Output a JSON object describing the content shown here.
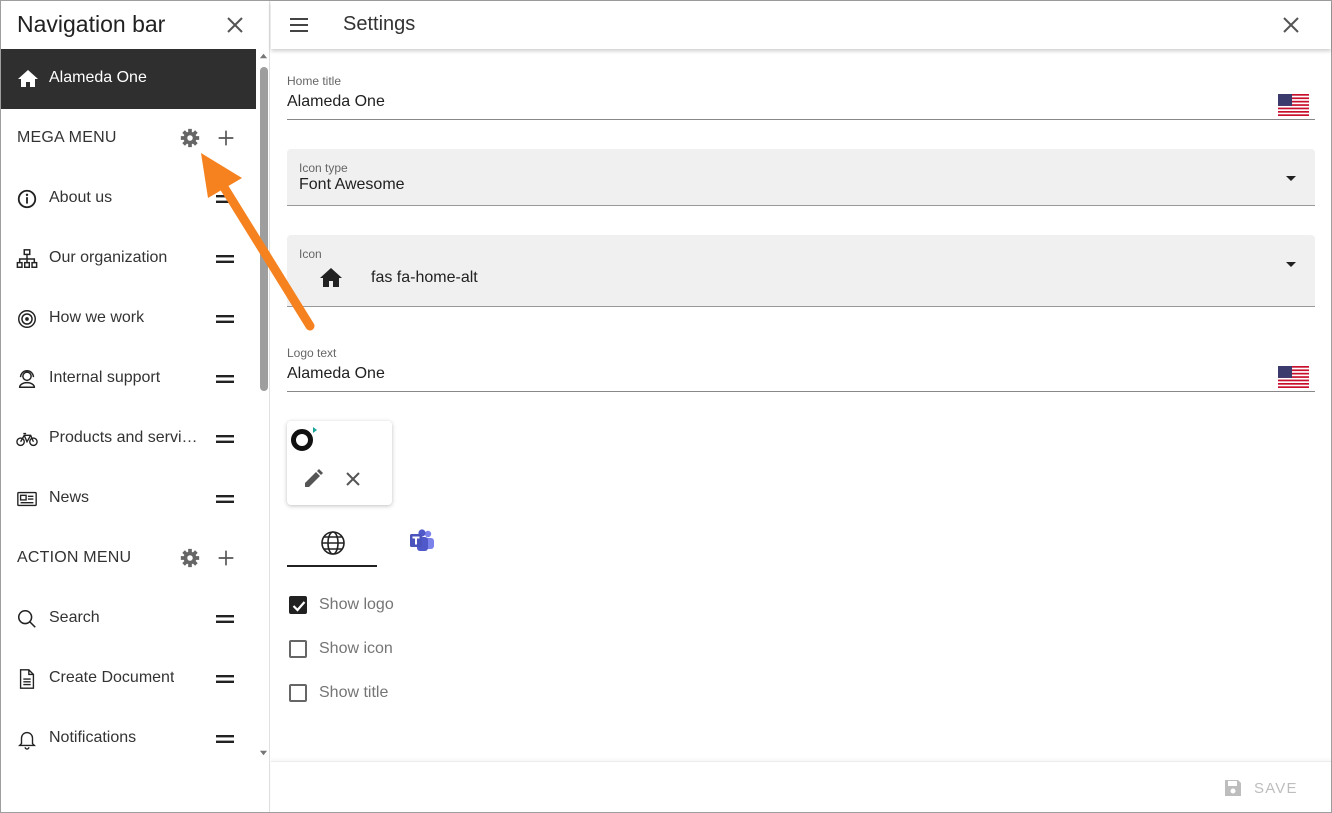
{
  "sidebar": {
    "title": "Navigation bar",
    "active_item": {
      "label": "Alameda One",
      "icon": "home-icon"
    },
    "mega_menu": {
      "label": "MEGA MENU",
      "items": [
        {
          "label": "About us",
          "icon": "info-circle-icon"
        },
        {
          "label": "Our organization",
          "icon": "sitemap-icon"
        },
        {
          "label": "How we work",
          "icon": "bullseye-icon"
        },
        {
          "label": "Internal support",
          "icon": "headset-icon"
        },
        {
          "label": "Products and services",
          "icon": "bicycle-icon"
        },
        {
          "label": "News",
          "icon": "newspaper-icon"
        }
      ]
    },
    "action_menu": {
      "label": "ACTION MENU",
      "items": [
        {
          "label": "Search",
          "icon": "search-icon"
        },
        {
          "label": "Create Document",
          "icon": "document-icon"
        },
        {
          "label": "Notifications",
          "icon": "bell-icon"
        }
      ]
    }
  },
  "settings": {
    "title": "Settings",
    "home_title": {
      "label": "Home title",
      "value": "Alameda One",
      "language": "en-US"
    },
    "icon_type": {
      "label": "Icon type",
      "value": "Font Awesome"
    },
    "icon": {
      "label": "Icon",
      "value": "fas fa-home-alt",
      "icon": "home-icon"
    },
    "logo_text": {
      "label": "Logo text",
      "value": "Alameda One",
      "language": "en-US"
    },
    "tabs": [
      {
        "name": "web",
        "icon": "globe-icon",
        "selected": true
      },
      {
        "name": "teams",
        "icon": "teams-icon",
        "selected": false
      }
    ],
    "checkboxes": [
      {
        "label": "Show logo",
        "checked": true
      },
      {
        "label": "Show icon",
        "checked": false
      },
      {
        "label": "Show title",
        "checked": false
      }
    ],
    "save_label": "SAVE"
  },
  "colors": {
    "active_bg": "#2f2f2f",
    "annotation_arrow": "#f5821f",
    "teams_purple": "#5059c9"
  }
}
